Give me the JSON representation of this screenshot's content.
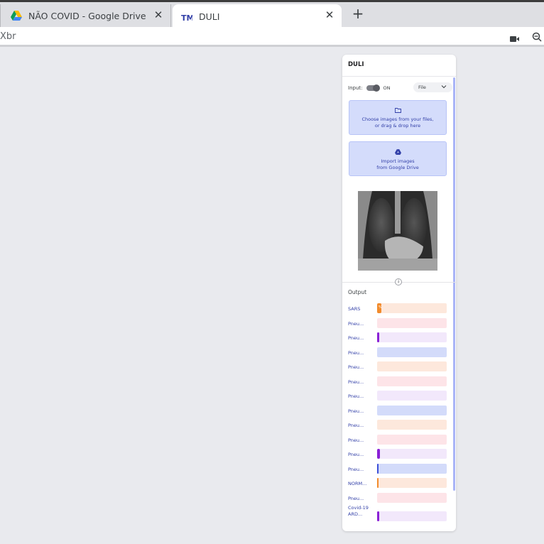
{
  "tabs": [
    {
      "title": "NÃO COVID - Google Drive",
      "icon": "google-drive-icon",
      "active": false
    },
    {
      "title": "DULI",
      "icon": "teachable-machine-icon",
      "active": true
    }
  ],
  "toolbar": {
    "url_fragment": "Xbr",
    "camera_icon": "camera-icon",
    "zoom_icon": "zoom-out-icon"
  },
  "panel": {
    "title": "DULI",
    "input": {
      "label": "Input:",
      "toggle_state": "ON",
      "source": "File"
    },
    "upload": {
      "line1": "Choose images from your files,",
      "line2": "or drag & drop here"
    },
    "drive": {
      "line1": "Import images",
      "line2": "from Google Drive"
    },
    "output_label": "Output",
    "predictions": [
      {
        "label": "SARS",
        "value": 6,
        "fill": "#f28b2c",
        "track": "#fde8dc",
        "show_pct": true
      },
      {
        "label": "Pneu...",
        "value": 0,
        "fill": "#e94c6d",
        "track": "#fde4e8"
      },
      {
        "label": "Pneu...",
        "value": 3,
        "fill": "#8a21d6",
        "track": "#f2e8fb"
      },
      {
        "label": "Pneu...",
        "value": 0,
        "fill": "#3b4fd8",
        "track": "#d3dbfa"
      },
      {
        "label": "Pneu...",
        "value": 0,
        "fill": "#f28b2c",
        "track": "#fde8dc"
      },
      {
        "label": "Pneu...",
        "value": 0,
        "fill": "#e94c6d",
        "track": "#fde4e8"
      },
      {
        "label": "Pneu...",
        "value": 0,
        "fill": "#8a21d6",
        "track": "#f2e8fb"
      },
      {
        "label": "Pneu...",
        "value": 0,
        "fill": "#3b4fd8",
        "track": "#d3dbfa"
      },
      {
        "label": "Pneu...",
        "value": 0,
        "fill": "#f28b2c",
        "track": "#fde8dc"
      },
      {
        "label": "Pneu...",
        "value": 0,
        "fill": "#e94c6d",
        "track": "#fde4e8"
      },
      {
        "label": "Pneu...",
        "value": 4,
        "fill": "#8a21d6",
        "track": "#f2e8fb"
      },
      {
        "label": "Pneu...",
        "value": 2,
        "fill": "#3b4fd8",
        "track": "#d3dbfa"
      },
      {
        "label": "NORM...",
        "value": 1,
        "fill": "#f28b2c",
        "track": "#fde8dc"
      },
      {
        "label": "Pneu...",
        "value": 0,
        "fill": "#e94c6d",
        "track": "#fde4e8"
      },
      {
        "label": "Covid-19 ARD...",
        "value": 3,
        "fill": "#8a21d6",
        "track": "#f2e8fb",
        "multi": true
      }
    ]
  }
}
